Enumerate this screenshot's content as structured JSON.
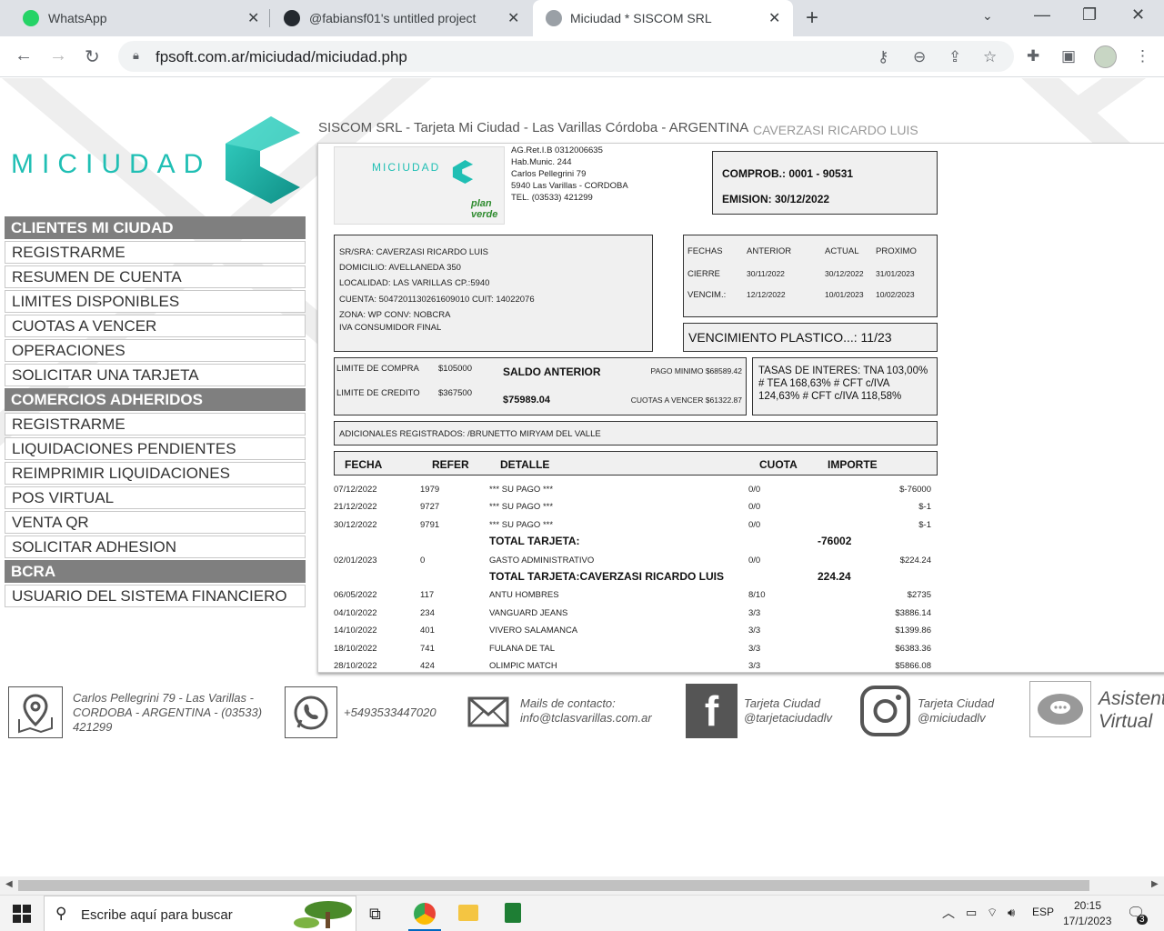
{
  "browser": {
    "tabs": [
      {
        "title": "WhatsApp"
      },
      {
        "title": "@fabiansf01's untitled project"
      },
      {
        "title": "Miciudad * SISCOM SRL"
      }
    ],
    "url": "fpsoft.com.ar/miciudad/miciudad.php"
  },
  "site": {
    "logo_text": "MICIUDAD",
    "header": "SISCOM SRL  - Tarjeta Mi Ciudad - Las Varillas  Córdoba - ARGENTINA",
    "user": "CAVERZASI RICARDO LUIS"
  },
  "menu": {
    "clientes_title": "CLIENTES MI CIUDAD",
    "clientes": [
      "REGISTRARME",
      "RESUMEN DE CUENTA",
      "LIMITES DISPONIBLES",
      "CUOTAS A VENCER",
      "OPERACIONES",
      "SOLICITAR UNA TARJETA"
    ],
    "comercios_title": "COMERCIOS ADHERIDOS",
    "comercios": [
      "REGISTRARME",
      "LIQUIDACIONES PENDIENTES",
      "REIMPRIMIR LIQUIDACIONES",
      "POS VIRTUAL",
      "VENTA QR",
      "SOLICITAR ADHESION"
    ],
    "bcra_title": "BCRA",
    "bcra": [
      "USUARIO DEL SISTEMA FINANCIERO"
    ]
  },
  "statement": {
    "mini_logo": "MICIUDAD",
    "plan_verde": "plan verde",
    "company_lines": [
      "AG.Ret.I.B 0312006635",
      "Hab.Munic. 244",
      "Carlos Pellegrini 79",
      "5940 Las Varillas - CORDOBA",
      "TEL. (03533) 421299"
    ],
    "comprob": "COMPROB.: 0001 - 90531",
    "emision": "EMISION: 30/12/2022",
    "client_lines": [
      "SR/SRA: CAVERZASI RICARDO LUIS",
      "DOMICILIO: AVELLANEDA 350",
      "LOCALIDAD: LAS VARILLAS CP.:5940",
      "CUENTA: 5047201130261609010 CUIT: 14022076",
      "ZONA: WP CONV: NOBCRA",
      "IVA CONSUMIDOR FINAL"
    ],
    "dates": {
      "headers": [
        "FECHAS",
        "ANTERIOR",
        "ACTUAL",
        "PROXIMO"
      ],
      "cierre": [
        "CIERRE",
        "30/11/2022",
        "30/12/2022",
        "31/01/2023"
      ],
      "vencim": [
        "VENCIM.:",
        "12/12/2022",
        "10/01/2023",
        "10/02/2023"
      ]
    },
    "venc_plastico": "VENCIMIENTO PLASTICO...: 11/23",
    "limite_compra_label": "LIMITE DE COMPRA",
    "limite_compra": "$105000",
    "limite_credito_label": "LIMITE DE CREDITO",
    "limite_credito": "$367500",
    "saldo_anterior_label": "SALDO ANTERIOR",
    "saldo_anterior": "$75989.04",
    "pago_minimo": "PAGO MINIMO $68589.42",
    "cuotas_a_vencer": "CUOTAS A VENCER $61322.87",
    "tasas": "TASAS DE INTERES: TNA 103,00% # TEA 168,63% # CFT c/IVA 124,63% # CFT c/IVA 118,58%",
    "adicionales": "ADICIONALES REGISTRADOS: /BRUNETTO MIRYAM DEL VALLE",
    "table_headers": [
      "FECHA",
      "REFER",
      "DETALLE",
      "CUOTA",
      "IMPORTE"
    ],
    "rows": [
      {
        "fecha": "07/12/2022",
        "refer": "1979",
        "detalle": "*** SU PAGO ***",
        "cuota": "0/0",
        "importe": "$-76000"
      },
      {
        "fecha": "21/12/2022",
        "refer": "9727",
        "detalle": "*** SU PAGO ***",
        "cuota": "0/0",
        "importe": "$-1"
      },
      {
        "fecha": "30/12/2022",
        "refer": "9791",
        "detalle": "*** SU PAGO ***",
        "cuota": "0/0",
        "importe": "$-1"
      }
    ],
    "total1_label": "TOTAL TARJETA:",
    "total1_value": "-76002",
    "rows2": [
      {
        "fecha": "02/01/2023",
        "refer": "0",
        "detalle": "GASTO ADMINISTRATIVO",
        "cuota": "0/0",
        "importe": "$224.24"
      }
    ],
    "total2_label": "TOTAL TARJETA:CAVERZASI RICARDO LUIS",
    "total2_value": "224.24",
    "rows3": [
      {
        "fecha": "06/05/2022",
        "refer": "117",
        "detalle": "ANTU HOMBRES",
        "cuota": "8/10",
        "importe": "$2735"
      },
      {
        "fecha": "04/10/2022",
        "refer": "234",
        "detalle": "VANGUARD JEANS",
        "cuota": "3/3",
        "importe": "$3886.14"
      },
      {
        "fecha": "14/10/2022",
        "refer": "401",
        "detalle": "VIVERO SALAMANCA",
        "cuota": "3/3",
        "importe": "$1399.86"
      },
      {
        "fecha": "18/10/2022",
        "refer": "741",
        "detalle": "FULANA DE TAL",
        "cuota": "3/3",
        "importe": "$6383.36"
      },
      {
        "fecha": "28/10/2022",
        "refer": "424",
        "detalle": "OLIMPIC MATCH",
        "cuota": "3/3",
        "importe": "$5866.08"
      }
    ]
  },
  "footer": {
    "address": "Carlos Pellegrini 79 -   Las Varillas - CORDOBA -  ARGENTINA  - (03533) 421299",
    "phone": "+5493533447020",
    "mails_label": "Mails de contacto:",
    "mail": "info@tclasvarillas.com.ar",
    "fb_label": "Tarjeta Ciudad",
    "fb_handle": "@tarjetaciudadlv",
    "ig_label": "Tarjeta Ciudad",
    "ig_handle": "@miciudadlv",
    "asistente": "Asistente Virtual"
  },
  "taskbar": {
    "search_placeholder": "Escribe aquí para buscar",
    "lang": "ESP",
    "time": "20:15",
    "date": "17/1/2023",
    "notif_count": "3"
  },
  "colors": {
    "accent": "#20bfb4",
    "menu_header": "#7f7f7f"
  }
}
